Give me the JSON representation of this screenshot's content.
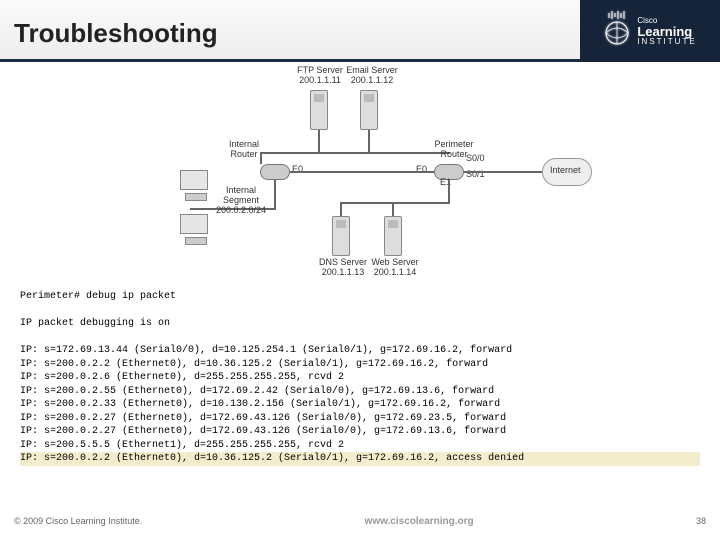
{
  "title": "Troubleshooting",
  "brand": {
    "small": "Cisco",
    "big": "Learning",
    "sub": "INSTITUTE"
  },
  "diagram": {
    "ftp": "FTP Server\n200.1.1.11",
    "email": "Email Server\n200.1.1.12",
    "internal_router": "Internal\nRouter",
    "perimeter_router": "Perimeter\nRouter",
    "seg": "Internal\nSegment\n200.0.2.0/24",
    "dns": "DNS Server\n200.1.1.13",
    "web": "Web Server\n200.1.1.14",
    "internet": "Internet",
    "e0a": "E0",
    "e0b": "E0",
    "e1": "E1",
    "s00": "S0/0",
    "s01": "S0/1"
  },
  "term": {
    "l1": "Perimeter# debug ip packet",
    "l2": "IP packet debugging is on",
    "l3": "IP: s=172.69.13.44 (Serial0/0), d=10.125.254.1 (Serial0/1), g=172.69.16.2, forward",
    "l4": "IP: s=200.0.2.2 (Ethernet0), d=10.36.125.2 (Serial0/1), g=172.69.16.2, forward",
    "l5": "IP: s=200.0.2.6 (Ethernet0), d=255.255.255.255, rcvd 2",
    "l6": "IP: s=200.0.2.55 (Ethernet0), d=172.69.2.42 (Serial0/0), g=172.69.13.6, forward",
    "l7": "IP: s=200.0.2.33 (Ethernet0), d=10.130.2.156 (Serial0/1), g=172.69.16.2, forward",
    "l8": "IP: s=200.0.2.27 (Ethernet0), d=172.69.43.126 (Serial0/0), g=172.69.23.5, forward",
    "l9": "IP: s=200.0.2.27 (Ethernet0), d=172.69.43.126 (Serial0/0), g=172.69.13.6, forward",
    "l10": "IP: s=200.5.5.5 (Ethernet1), d=255.255.255.255, rcvd 2",
    "l11": "IP: s=200.0.2.2 (Ethernet0), d=10.36.125.2 (Serial0/1), g=172.69.16.2, access denied"
  },
  "footer": {
    "copy": "© 2009 Cisco Learning Institute.",
    "url": "www.ciscolearning.org",
    "page": "38"
  }
}
